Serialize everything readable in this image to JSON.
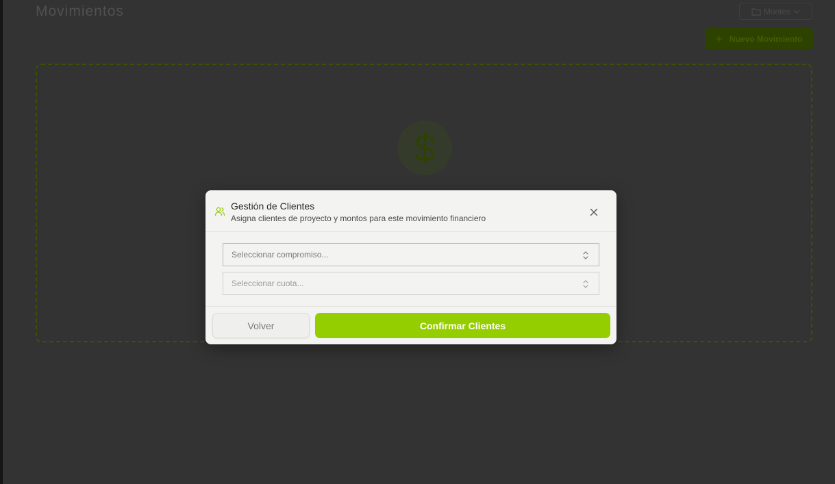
{
  "page": {
    "title": "Movimientos",
    "folder_select_label": "Montes",
    "new_movement_button": "Nuevo Movimiento"
  },
  "modal": {
    "title": "Gestión de Clientes",
    "subtitle": "Asigna clientes de proyecto y montos para este movimiento financiero",
    "commitment_select_placeholder": "Seleccionar compromiso...",
    "installment_select_placeholder": "Seleccionar cuota...",
    "back_button": "Volver",
    "confirm_button": "Confirmar Clientes"
  },
  "icons": {
    "header": "users-icon",
    "close": "close-icon",
    "select": "chevron-up-down-icon",
    "empty_state": "dollar-icon",
    "folder": "folder-icon",
    "plus": "plus-icon"
  },
  "colors": {
    "accent": "#95ce00",
    "overlay_background": "#333333",
    "modal_background": "#f3f3f1"
  }
}
